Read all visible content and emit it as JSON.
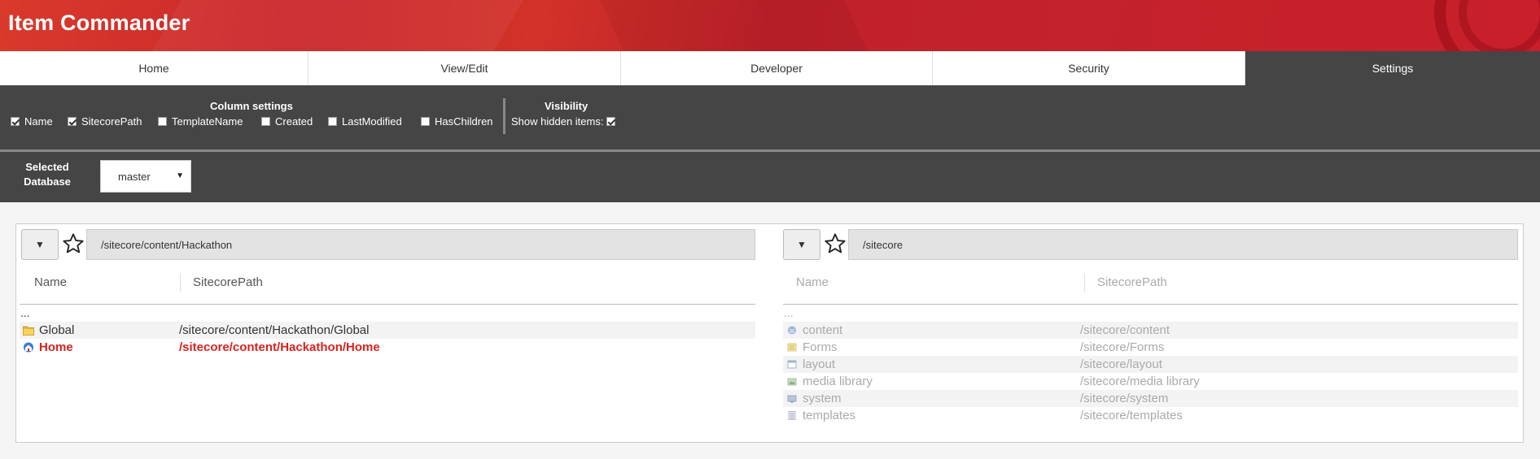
{
  "app": {
    "title": "Item Commander"
  },
  "tabs": [
    {
      "label": "Home"
    },
    {
      "label": "View/Edit"
    },
    {
      "label": "Developer"
    },
    {
      "label": "Security"
    },
    {
      "label": "Settings",
      "active": true
    }
  ],
  "column_settings": {
    "title": "Column settings",
    "options": [
      {
        "label": "Name",
        "checked": true
      },
      {
        "label": "SitecorePath",
        "checked": true
      },
      {
        "label": "TemplateName",
        "checked": false
      },
      {
        "label": "Created",
        "checked": false
      },
      {
        "label": "LastModified",
        "checked": false
      },
      {
        "label": "HasChildren",
        "checked": false
      }
    ]
  },
  "visibility": {
    "title": "Visibility",
    "show_hidden_label": "Show hidden items:",
    "show_hidden_checked": true
  },
  "database": {
    "label": "Selected Database",
    "value": "master",
    "arrow": "▼"
  },
  "left_pane": {
    "path": "/sitecore/content/Hackathon",
    "columns": [
      "Name",
      "SitecorePath"
    ],
    "parent": "...",
    "rows": [
      {
        "name": "Global",
        "path": "/sitecore/content/Hackathon/Global",
        "icon": "folder-icon"
      },
      {
        "name": "Home",
        "path": "/sitecore/content/Hackathon/Home",
        "icon": "home-icon",
        "selected": true
      }
    ]
  },
  "right_pane": {
    "path": "/sitecore",
    "columns": [
      "Name",
      "SitecorePath"
    ],
    "parent": "...",
    "rows": [
      {
        "name": "content",
        "path": "/sitecore/content",
        "icon": "content-icon"
      },
      {
        "name": "Forms",
        "path": "/sitecore/Forms",
        "icon": "forms-icon"
      },
      {
        "name": "layout",
        "path": "/sitecore/layout",
        "icon": "layout-icon"
      },
      {
        "name": "media library",
        "path": "/sitecore/media library",
        "icon": "media-library-icon"
      },
      {
        "name": "system",
        "path": "/sitecore/system",
        "icon": "system-icon"
      },
      {
        "name": "templates",
        "path": "/sitecore/templates",
        "icon": "templates-icon"
      }
    ]
  },
  "colors": {
    "brand_red": "#c9262b",
    "ribbon": "#454545",
    "selected_text": "#d9221f"
  }
}
